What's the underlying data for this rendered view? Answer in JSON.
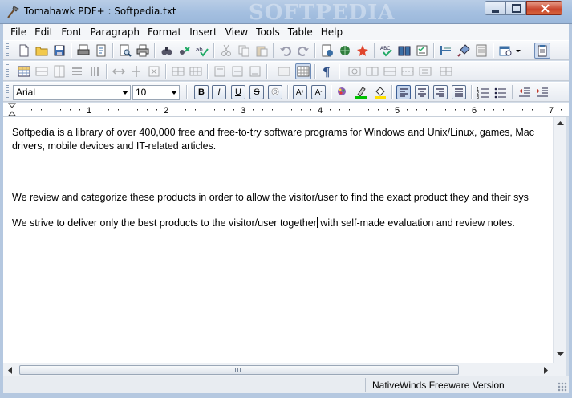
{
  "window": {
    "title": "Tomahawk PDF+ : Softpedia.txt",
    "watermark": "SOFTPEDIA"
  },
  "menu": [
    "File",
    "Edit",
    "Font",
    "Paragraph",
    "Format",
    "Insert",
    "View",
    "Tools",
    "Table",
    "Help"
  ],
  "format_bar": {
    "font_name": "Arial",
    "font_size": "10",
    "bold": "B",
    "italic": "I",
    "underline": "U",
    "strike": "S",
    "outline": "O",
    "superscript": "A",
    "subscript": "A"
  },
  "ruler": {
    "marks": [
      "1",
      "2",
      "3",
      "4",
      "5",
      "6",
      "7"
    ]
  },
  "document": {
    "lines": [
      "Softpedia is a library of over 400,000 free and free-to-try software programs for Windows and Unix/Linux, games, Mac",
      "drivers, mobile devices and IT-related articles.",
      "We review and categorize these products in order to allow the visitor/user to find the exact product they and their sys",
      "We strive to deliver only the best products to the visitor/user together",
      " with self-made evaluation and review notes."
    ]
  },
  "statusbar": {
    "text": "NativeWinds Freeware Version"
  },
  "icons": {
    "app": "tomahawk-icon",
    "accent": "#3a6ea5"
  }
}
